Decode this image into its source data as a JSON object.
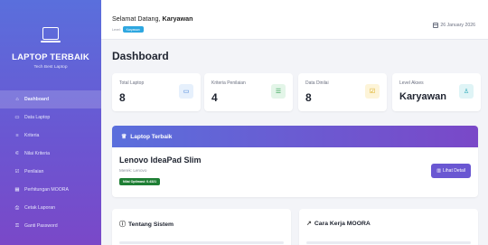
{
  "sidebar": {
    "brand_title": "LAPTOP TERBAIK",
    "brand_subtitle": "Tech Best Laptop",
    "items": [
      {
        "label": "Dashboard",
        "icon": "home-icon",
        "glyph": "⌂"
      },
      {
        "label": "Data Laptop",
        "icon": "laptop-icon",
        "glyph": "▭"
      },
      {
        "label": "Kriteria",
        "icon": "list-icon",
        "glyph": "≡"
      },
      {
        "label": "Nilai Kriteria",
        "icon": "sliders-icon",
        "glyph": "⚟"
      },
      {
        "label": "Penilaian",
        "icon": "checkbox-icon",
        "glyph": "☑"
      },
      {
        "label": "Perhitungan MOORA",
        "icon": "calculator-icon",
        "glyph": "▦"
      },
      {
        "label": "Cetak Laporan",
        "icon": "printer-icon",
        "glyph": "⎙"
      },
      {
        "label": "Ganti Password",
        "icon": "key-icon",
        "glyph": "⚿"
      }
    ]
  },
  "header": {
    "welcome_prefix": "Selamat Datang, ",
    "username": "Karyawan",
    "level_label": "Level:",
    "level_value": "Karyawan",
    "date": "26 January 2026"
  },
  "main": {
    "title": "Dashboard",
    "stats": [
      {
        "label": "Total Laptop",
        "value": "8",
        "icon": "monitor-icon",
        "glyph": "▭",
        "color": "#3a7bd5",
        "bg": "#e6f0fc"
      },
      {
        "label": "Kriteria Penilaian",
        "value": "4",
        "icon": "list-icon",
        "glyph": "☰",
        "color": "#2ea04f",
        "bg": "#e3f5e8"
      },
      {
        "label": "Data Dinilai",
        "value": "8",
        "icon": "check-square-icon",
        "glyph": "☑",
        "color": "#d6a40c",
        "bg": "#fdf4d8"
      },
      {
        "label": "Level Akses",
        "value": "Karyawan",
        "icon": "user-icon",
        "glyph": "♙",
        "color": "#2aa8b8",
        "bg": "#dff4f6"
      }
    ],
    "best": {
      "heading": "Laptop Terbaik",
      "name": "Lenovo IdeaPad Slim",
      "brand": "Merek: Lenovo",
      "score": "Nilai Optimasi: 0.4321",
      "button": "Lihat Detail"
    },
    "info_cards": [
      {
        "title": "Tentang Sistem",
        "icon": "info-icon",
        "glyph": "ⓘ"
      },
      {
        "title": "Cara Kerja MOORA",
        "icon": "chart-line-icon",
        "glyph": "↗"
      }
    ]
  }
}
